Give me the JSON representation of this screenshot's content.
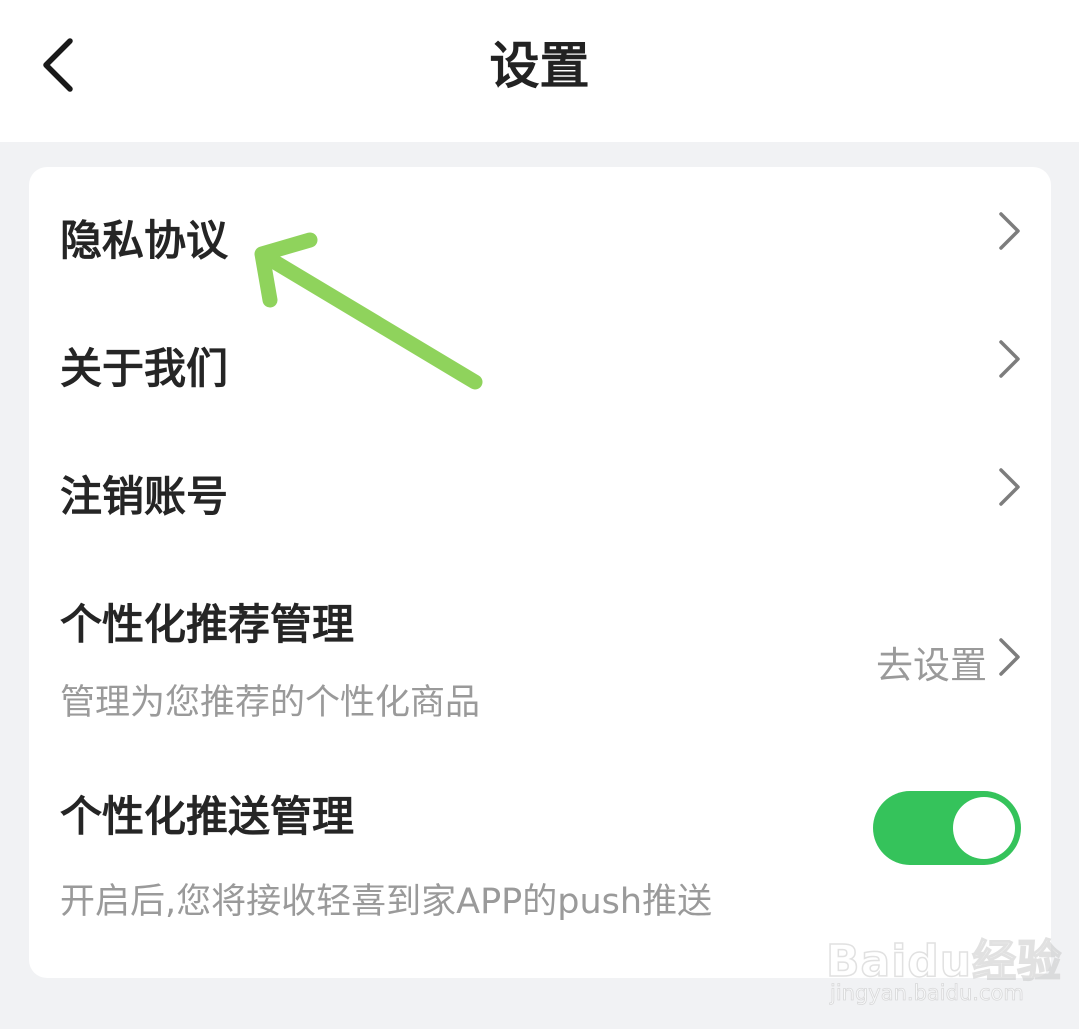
{
  "header": {
    "title": "设置",
    "back_icon": "chevron-left-icon"
  },
  "settings": {
    "items": [
      {
        "title": "隐私协议",
        "icon": "chevron-right-icon"
      },
      {
        "title": "关于我们",
        "icon": "chevron-right-icon"
      },
      {
        "title": "注销账号",
        "icon": "chevron-right-icon"
      }
    ],
    "recommend": {
      "title": "个性化推荐管理",
      "subtitle": "管理为您推荐的个性化商品",
      "action_label": "去设置",
      "icon": "chevron-right-icon"
    },
    "push": {
      "title": "个性化推送管理",
      "subtitle": "开启后,您将接收轻喜到家APP的push推送",
      "toggle_on": true
    }
  },
  "annotation": {
    "arrow_color": "#8fd35c"
  },
  "watermark": {
    "brand": "Baidu经验",
    "url": "jingyan.baidu.com"
  },
  "colors": {
    "toggle_on": "#35c35b",
    "background": "#f1f2f4"
  }
}
